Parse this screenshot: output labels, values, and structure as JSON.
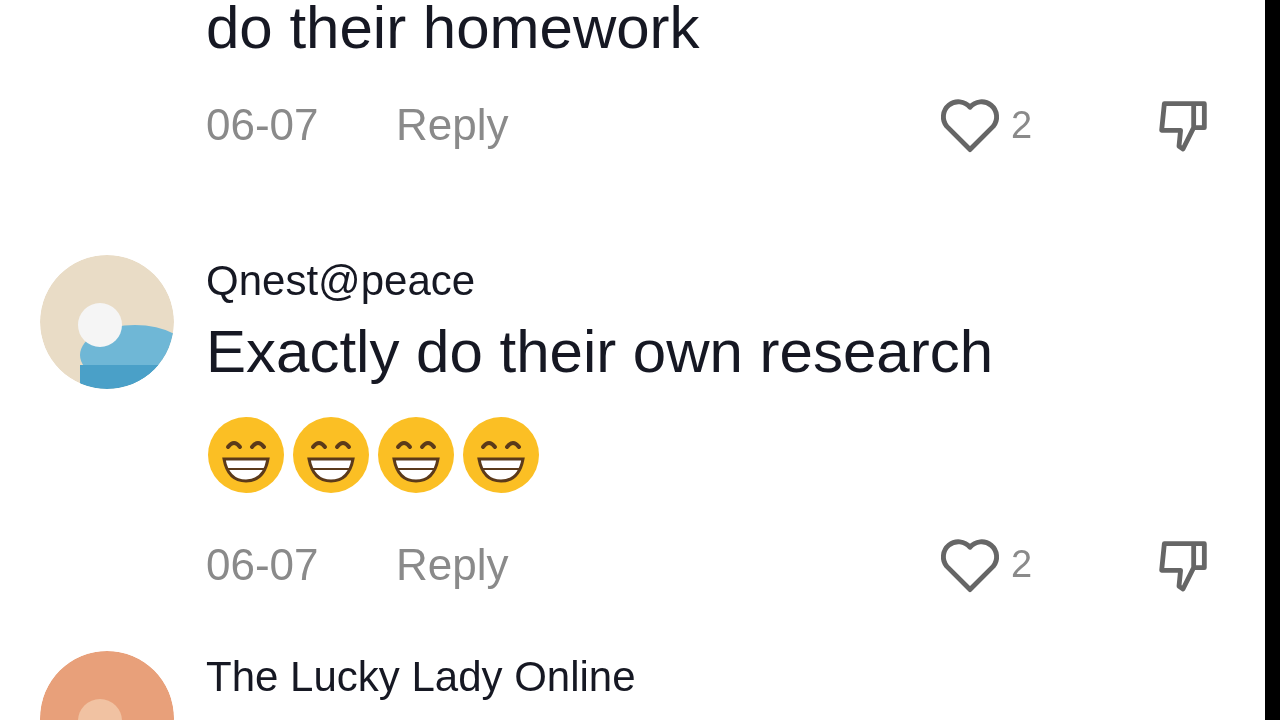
{
  "comments": [
    {
      "text": "do their homework",
      "date": "06-07",
      "reply": "Reply",
      "likes": "2",
      "liked": false
    },
    {
      "user": "Qnest@peace",
      "text": "Exactly do their own research",
      "emojis": [
        {
          "kind": "grin"
        },
        {
          "kind": "grin"
        },
        {
          "kind": "grin"
        },
        {
          "kind": "grin"
        }
      ],
      "date": "06-07",
      "reply": "Reply",
      "likes": "2",
      "liked": false
    },
    {
      "user": "The Lucky Lady Online"
    }
  ]
}
